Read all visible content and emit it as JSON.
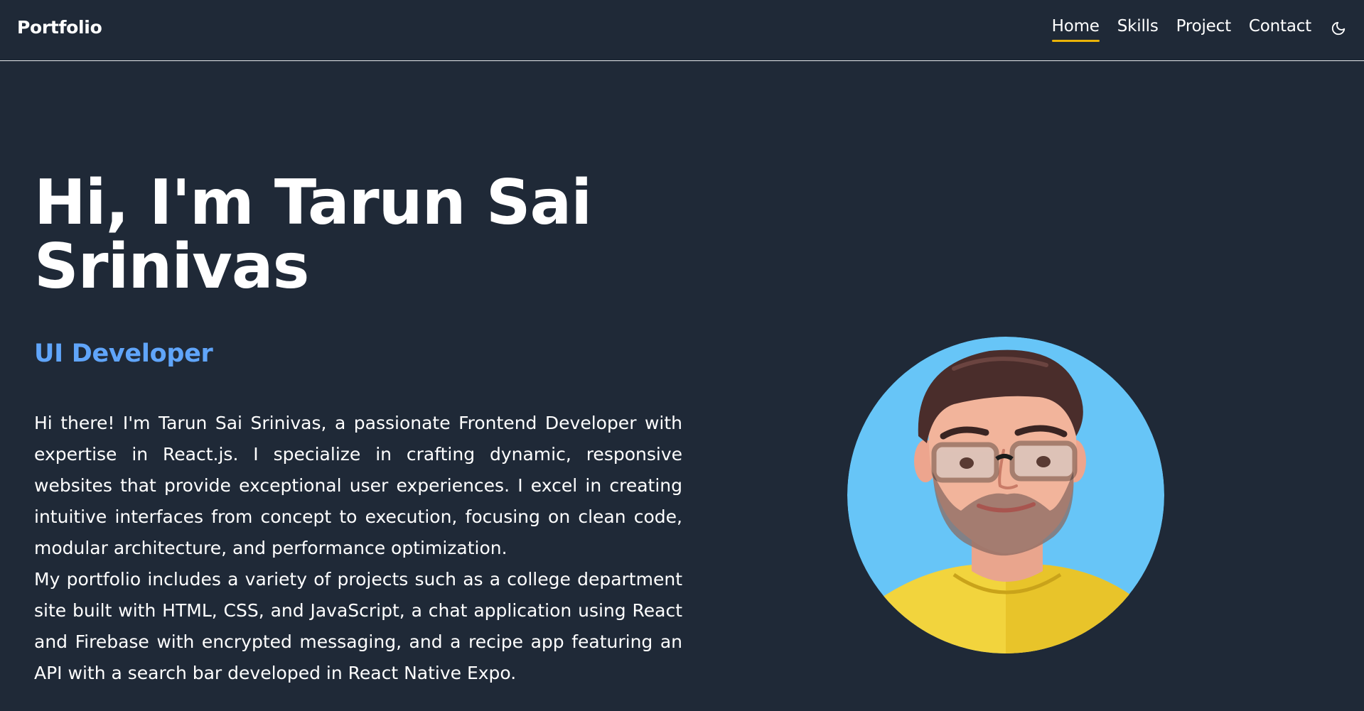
{
  "nav": {
    "brand": "Portfolio",
    "links": [
      {
        "label": "Home",
        "active": true
      },
      {
        "label": "Skills",
        "active": false
      },
      {
        "label": "Project",
        "active": false
      },
      {
        "label": "Contact",
        "active": false
      }
    ],
    "theme_icon": "moon-icon"
  },
  "hero": {
    "title": "Hi, I'm Tarun Sai Srinivas",
    "role": "UI Developer",
    "paragraphs": [
      "Hi there! I'm Tarun Sai Srinivas, a passionate Frontend Developer with expertise in React.js. I specialize in crafting dynamic, responsive websites that provide exceptional user experiences. I excel in creating intuitive interfaces from concept to execution, focusing on clean code, modular architecture, and performance optimization.",
      "My portfolio includes a variety of projects such as a college department site built with HTML, CSS, and JavaScript, a chat application using React and Firebase with encrypted messaging, and a recipe app featuring an API with a search bar developed in React Native Expo."
    ],
    "avatar_icon": "avatar-illustration"
  },
  "colors": {
    "background": "#1f2937",
    "accent_underline": "#eab308",
    "role_text": "#60a5fa",
    "avatar_bg": "#67c5f7"
  }
}
